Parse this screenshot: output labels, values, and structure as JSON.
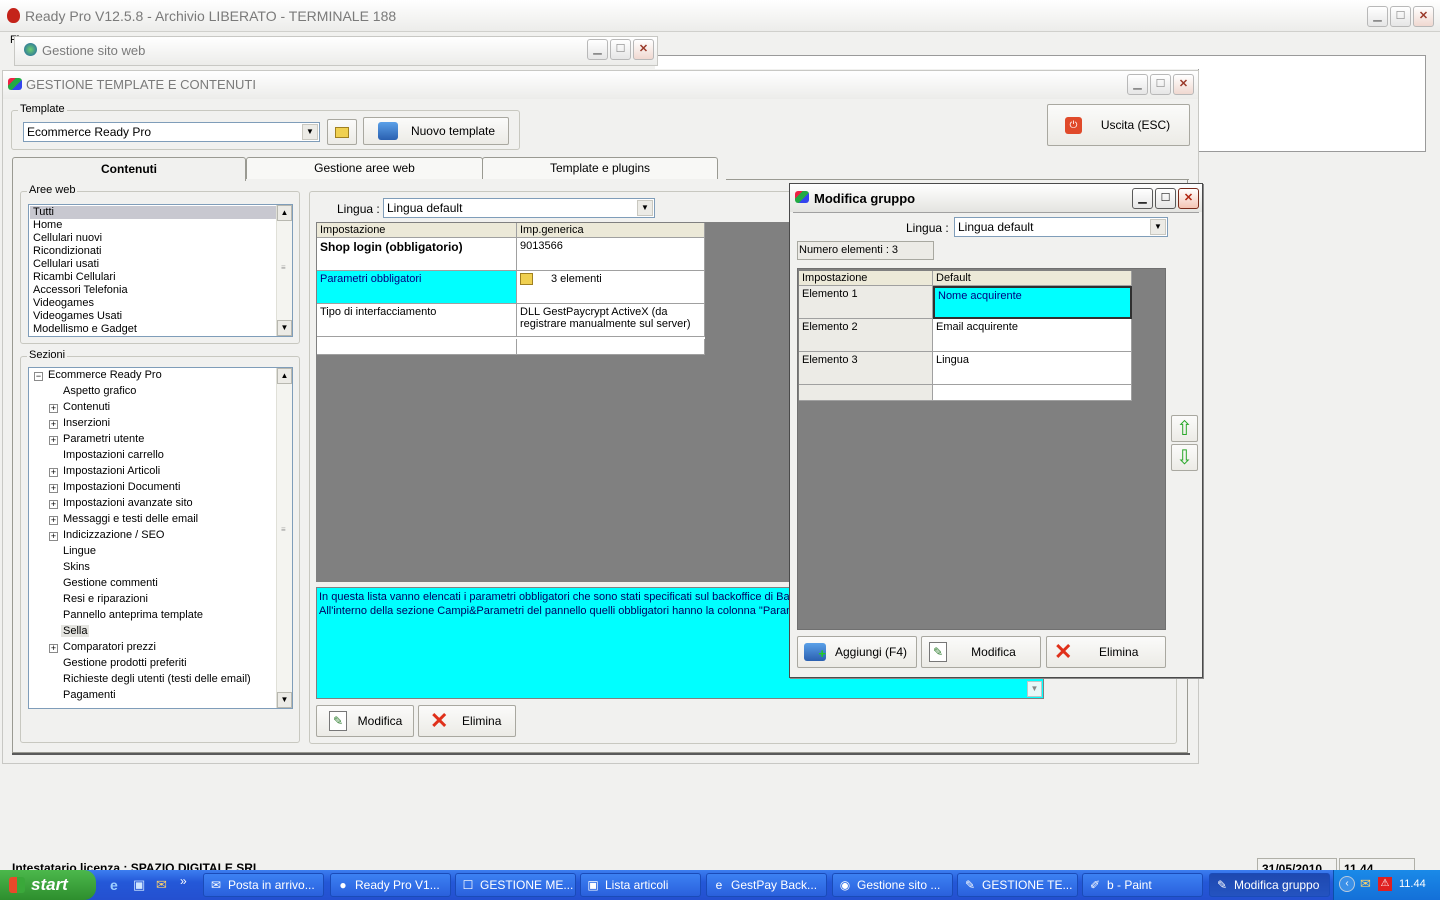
{
  "main_window": {
    "title": "Ready Pro V12.5.8 - Archivio LIBERATO - TERMINALE 188",
    "menu_fragment": "Fi"
  },
  "site_window": {
    "title": "Gestione sito web"
  },
  "template_window": {
    "title": "GESTIONE TEMPLATE E CONTENUTI",
    "template_group_label": "Template",
    "template_value": "Ecommerce Ready Pro",
    "new_template_button": "Nuovo template",
    "exit_button": "Uscita (ESC)",
    "tabs": [
      "Contenuti",
      "Gestione aree web",
      "Template e plugins"
    ],
    "active_tab": "Contenuti",
    "aree_web_label": "Aree web",
    "aree_web": [
      "Tutti",
      "Home",
      "Cellulari nuovi",
      "Ricondizionati",
      "Cellulari usati",
      "Ricambi Cellulari",
      "Accessori Telefonia",
      "Videogames",
      "Videogames Usati",
      "Modellismo e Gadget"
    ],
    "sezioni_label": "Sezioni",
    "sezioni_root": "Ecommerce Ready Pro",
    "sezioni": [
      {
        "label": "Aspetto grafico",
        "expandable": false
      },
      {
        "label": "Contenuti",
        "expandable": true
      },
      {
        "label": "Inserzioni",
        "expandable": true
      },
      {
        "label": "Parametri utente",
        "expandable": true
      },
      {
        "label": "Impostazioni carrello",
        "expandable": false
      },
      {
        "label": "Impostazioni Articoli",
        "expandable": true
      },
      {
        "label": "Impostazioni Documenti",
        "expandable": true
      },
      {
        "label": "Impostazioni avanzate sito",
        "expandable": true
      },
      {
        "label": "Messaggi e testi delle email",
        "expandable": true
      },
      {
        "label": "Indicizzazione / SEO",
        "expandable": true
      },
      {
        "label": "Lingue",
        "expandable": false
      },
      {
        "label": "Skins",
        "expandable": false
      },
      {
        "label": "Gestione commenti",
        "expandable": false
      },
      {
        "label": "Resi e riparazioni",
        "expandable": false
      },
      {
        "label": "Pannello anteprima template",
        "expandable": false
      },
      {
        "label": "Sella",
        "expandable": false
      },
      {
        "label": "Comparatori prezzi",
        "expandable": true
      },
      {
        "label": "Gestione prodotti preferiti",
        "expandable": false
      },
      {
        "label": "Richieste degli utenti (testi delle email)",
        "expandable": false
      },
      {
        "label": "Pagamenti",
        "expandable": false
      }
    ],
    "lingua_label": "Lingua :",
    "lingua_value": "Lingua default",
    "grid_headers": [
      "Impostazione",
      "Imp.generica"
    ],
    "grid_rows": [
      {
        "setting": "Shop login (obbligatorio)",
        "value": "9013566",
        "bold": true,
        "selected": false
      },
      {
        "setting": "Parametri obbligatori",
        "value": "3 elementi",
        "bold": false,
        "selected": true
      },
      {
        "setting": "Tipo di interfacciamento",
        "value": "DLL GestPaycrypt ActiveX (da registrare manualmente sul server)",
        "bold": false,
        "selected": false
      }
    ],
    "description_lines": [
      "In questa lista vanno elencati i parametri obbligatori che sono stati specificati sul backoffice di Ban",
      "All'interno della sezione Campi&Parametri del pannello quelli obbligatori hanno la colonna \"Parametr"
    ],
    "modify_button": "Modifica",
    "delete_button": "Elimina"
  },
  "dialog": {
    "title": "Modifica gruppo",
    "lingua_label": "Lingua :",
    "lingua_value": "Lingua default",
    "count_text": "Numero elementi : 3",
    "grid_headers": [
      "Impostazione",
      "Default"
    ],
    "rows": [
      {
        "setting": "Elemento 1",
        "value": "Nome acquirente",
        "selected": true
      },
      {
        "setting": "Elemento 2",
        "value": "Email acquirente",
        "selected": false
      },
      {
        "setting": "Elemento 3",
        "value": "Lingua",
        "selected": false
      }
    ],
    "add_button": "Aggiungi (F4)",
    "modify_button": "Modifica",
    "delete_button": "Elimina"
  },
  "status_bar": {
    "license": "Intestatario licenza : SPAZIO DIGITALE SRL",
    "date": "31/05/2010",
    "time": "11.44"
  },
  "taskbar": {
    "start_label": "start",
    "items": [
      {
        "label": "Posta in arrivo...",
        "icon": "✉",
        "active": false
      },
      {
        "label": "Ready Pro V1...",
        "icon": "●",
        "active": false
      },
      {
        "label": "GESTIONE ME...",
        "icon": "☐",
        "active": false
      },
      {
        "label": "Lista articoli",
        "icon": "▣",
        "active": false
      },
      {
        "label": "GestPay Back...",
        "icon": "e",
        "active": false
      },
      {
        "label": "Gestione sito ...",
        "icon": "◉",
        "active": false
      },
      {
        "label": "GESTIONE TE...",
        "icon": "✎",
        "active": false
      },
      {
        "label": "b - Paint",
        "icon": "✐",
        "active": false
      },
      {
        "label": "Modifica gruppo",
        "icon": "✎",
        "active": true
      }
    ],
    "clock": "11.44"
  }
}
